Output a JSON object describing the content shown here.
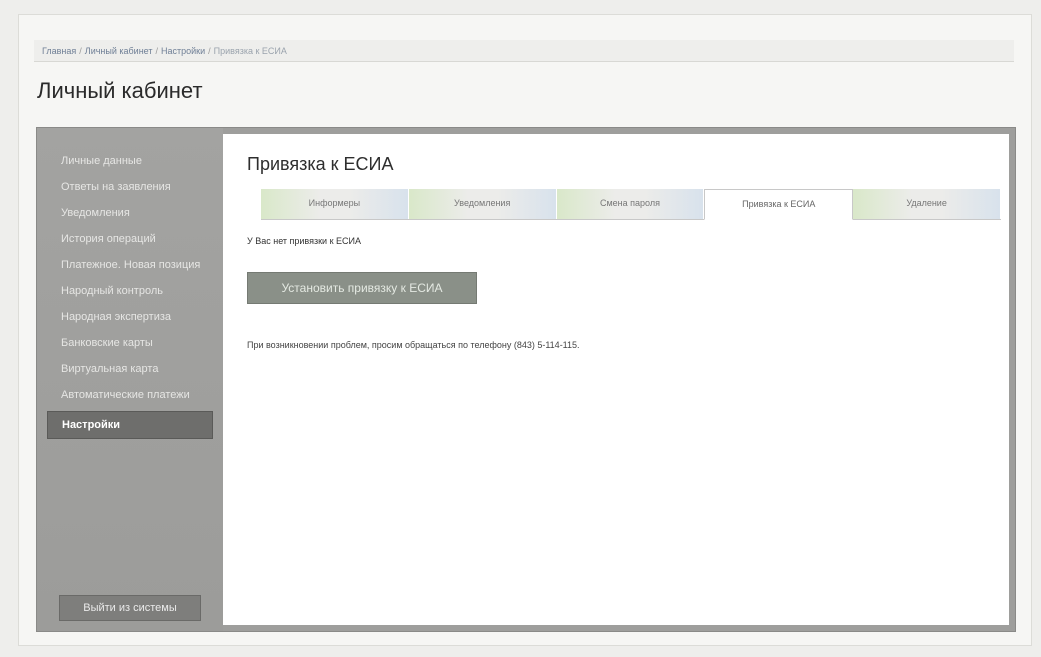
{
  "breadcrumb": {
    "items": [
      "Главная",
      "Личный кабинет",
      "Настройки",
      "Привязка к ЕСИА"
    ],
    "separator": "/"
  },
  "page_title": "Личный кабинет",
  "sidebar": {
    "items": [
      {
        "label": "Личные данные"
      },
      {
        "label": "Ответы на заявления"
      },
      {
        "label": "Уведомления"
      },
      {
        "label": "История операций"
      },
      {
        "label": "Платежное. Новая позиция"
      },
      {
        "label": "Народный контроль"
      },
      {
        "label": "Народная экспертиза"
      },
      {
        "label": "Банковские карты"
      },
      {
        "label": "Виртуальная карта"
      },
      {
        "label": "Автоматические платежи"
      },
      {
        "label": "Настройки",
        "active": true
      }
    ],
    "logout_label": "Выйти из системы"
  },
  "content": {
    "title": "Привязка к ЕСИА",
    "tabs": [
      {
        "label": "Информеры"
      },
      {
        "label": "Уведомления"
      },
      {
        "label": "Смена пароля"
      },
      {
        "label": "Привязка к ЕСИА",
        "active": true
      },
      {
        "label": "Удаление"
      }
    ],
    "status_text": "У Вас нет привязки к ЕСИА",
    "esia_button_label": "Установить привязку к ЕСИА",
    "help_text": "При возникновении проблем, просим обращаться по телефону (843) 5-114-115."
  },
  "colors": {
    "sidebar_bg": "#9e9e9c",
    "active_item_bg": "#6e6e6c",
    "button_bg": "#8a9088",
    "content_bg": "#ffffff"
  }
}
